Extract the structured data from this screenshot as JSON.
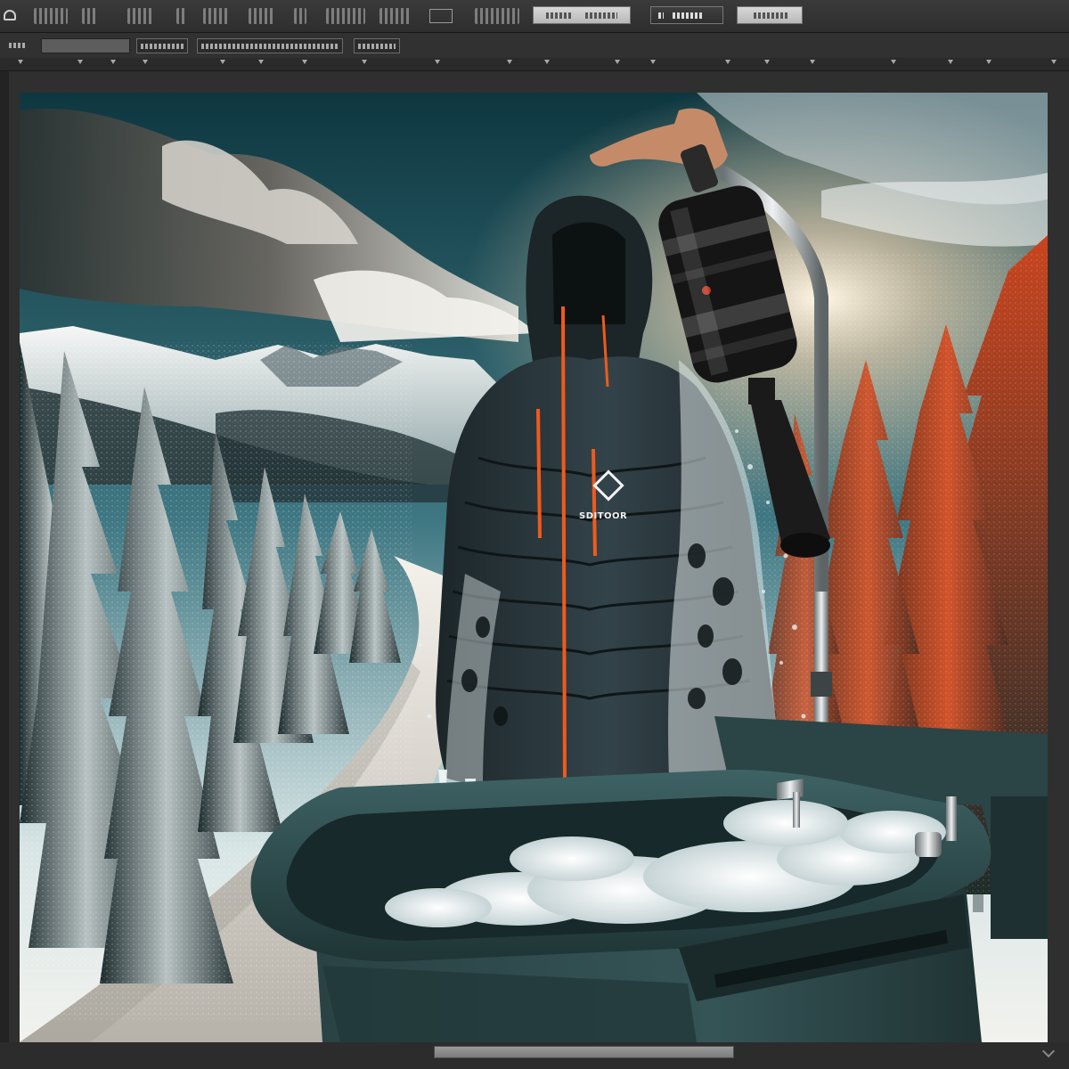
{
  "menubar": {
    "items": [
      "",
      "",
      "",
      "",
      "",
      "",
      "",
      "",
      "",
      ""
    ],
    "buttons": [
      "",
      "",
      ""
    ]
  },
  "optionsbar": {
    "field_value": "",
    "labels": [
      "",
      "",
      ""
    ]
  },
  "canvas": {
    "jacket_logo_text": "SDITOOR"
  },
  "colors": {
    "accent_orange": "#f05a1c",
    "jacket": "#2a3438",
    "tub": "#2f4a4e"
  }
}
